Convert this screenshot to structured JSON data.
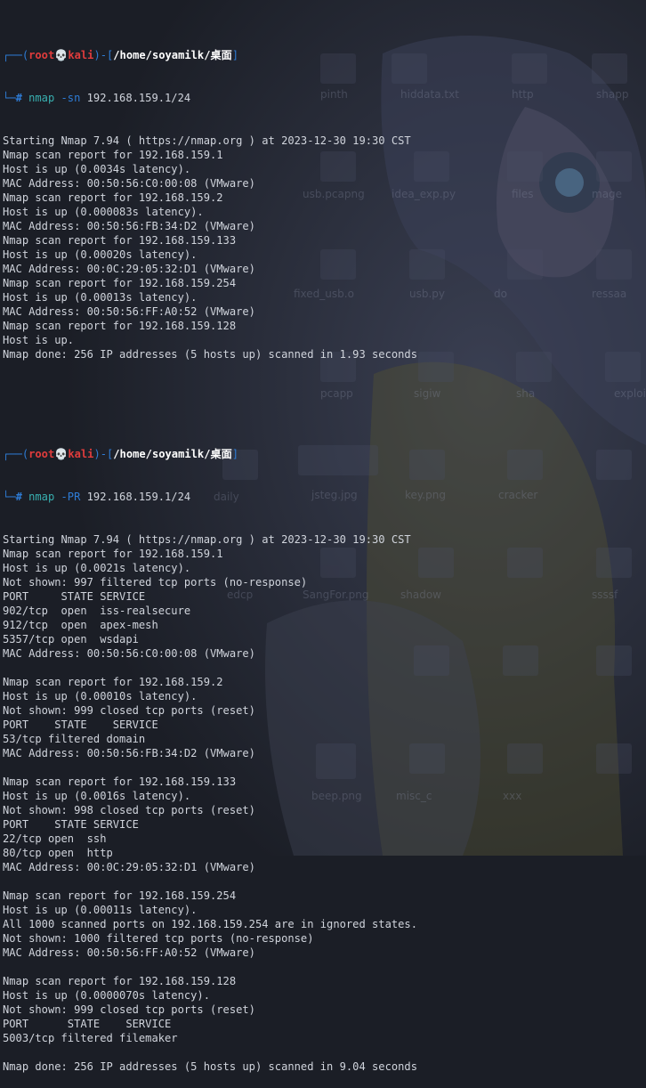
{
  "window": {
    "colors": {
      "prompt": "#2e7cd6",
      "user": "#e03c3c",
      "path": "#ffffff",
      "command": "#38b0b0",
      "text": "#d0d4dc"
    }
  },
  "prompt": {
    "user": "root",
    "skull": "💀",
    "host": "kali",
    "path": "/home/soyamilk/桌面",
    "symbol": "#"
  },
  "blocks": [
    {
      "command": "nmap",
      "flag": "-sn",
      "args": "192.168.159.1/24",
      "output": [
        "Starting Nmap 7.94 ( https://nmap.org ) at 2023-12-30 19:30 CST",
        "Nmap scan report for 192.168.159.1",
        "Host is up (0.0034s latency).",
        "MAC Address: 00:50:56:C0:00:08 (VMware)",
        "Nmap scan report for 192.168.159.2",
        "Host is up (0.000083s latency).",
        "MAC Address: 00:50:56:FB:34:D2 (VMware)",
        "Nmap scan report for 192.168.159.133",
        "Host is up (0.00020s latency).",
        "MAC Address: 00:0C:29:05:32:D1 (VMware)",
        "Nmap scan report for 192.168.159.254",
        "Host is up (0.00013s latency).",
        "MAC Address: 00:50:56:FF:A0:52 (VMware)",
        "Nmap scan report for 192.168.159.128",
        "Host is up.",
        "Nmap done: 256 IP addresses (5 hosts up) scanned in 1.93 seconds"
      ]
    },
    {
      "command": "nmap",
      "flag": "-PR",
      "args": "192.168.159.1/24",
      "output": [
        "Starting Nmap 7.94 ( https://nmap.org ) at 2023-12-30 19:30 CST",
        "Nmap scan report for 192.168.159.1",
        "Host is up (0.0021s latency).",
        "Not shown: 997 filtered tcp ports (no-response)",
        "PORT     STATE SERVICE",
        "902/tcp  open  iss-realsecure",
        "912/tcp  open  apex-mesh",
        "5357/tcp open  wsdapi",
        "MAC Address: 00:50:56:C0:00:08 (VMware)",
        "",
        "Nmap scan report for 192.168.159.2",
        "Host is up (0.00010s latency).",
        "Not shown: 999 closed tcp ports (reset)",
        "PORT    STATE    SERVICE",
        "53/tcp filtered domain",
        "MAC Address: 00:50:56:FB:34:D2 (VMware)",
        "",
        "Nmap scan report for 192.168.159.133",
        "Host is up (0.0016s latency).",
        "Not shown: 998 closed tcp ports (reset)",
        "PORT    STATE SERVICE",
        "22/tcp open  ssh",
        "80/tcp open  http",
        "MAC Address: 00:0C:29:05:32:D1 (VMware)",
        "",
        "Nmap scan report for 192.168.159.254",
        "Host is up (0.00011s latency).",
        "All 1000 scanned ports on 192.168.159.254 are in ignored states.",
        "Not shown: 1000 filtered tcp ports (no-response)",
        "MAC Address: 00:50:56:FF:A0:52 (VMware)",
        "",
        "Nmap scan report for 192.168.159.128",
        "Host is up (0.0000070s latency).",
        "Not shown: 999 closed tcp ports (reset)",
        "PORT      STATE    SERVICE",
        "5003/tcp filtered filemaker",
        "",
        "Nmap done: 256 IP addresses (5 hosts up) scanned in 9.04 seconds"
      ]
    }
  ],
  "desktop_labels": [
    "pinth",
    "hiddata.txt",
    "http",
    "shapp",
    "usb.pcapng",
    "idea_exp.py",
    "files",
    "mage",
    "fixed_usb.o",
    "usb.py",
    "do",
    "ressaa",
    "pcapp",
    "sigiw",
    "sha",
    "exploit",
    "daily",
    "jsteg.jpg",
    "key.png",
    "cracker",
    "edcp",
    "SangFor.png",
    "shadow",
    "ssssf",
    "beep.png",
    "misc_c",
    "xxx"
  ]
}
